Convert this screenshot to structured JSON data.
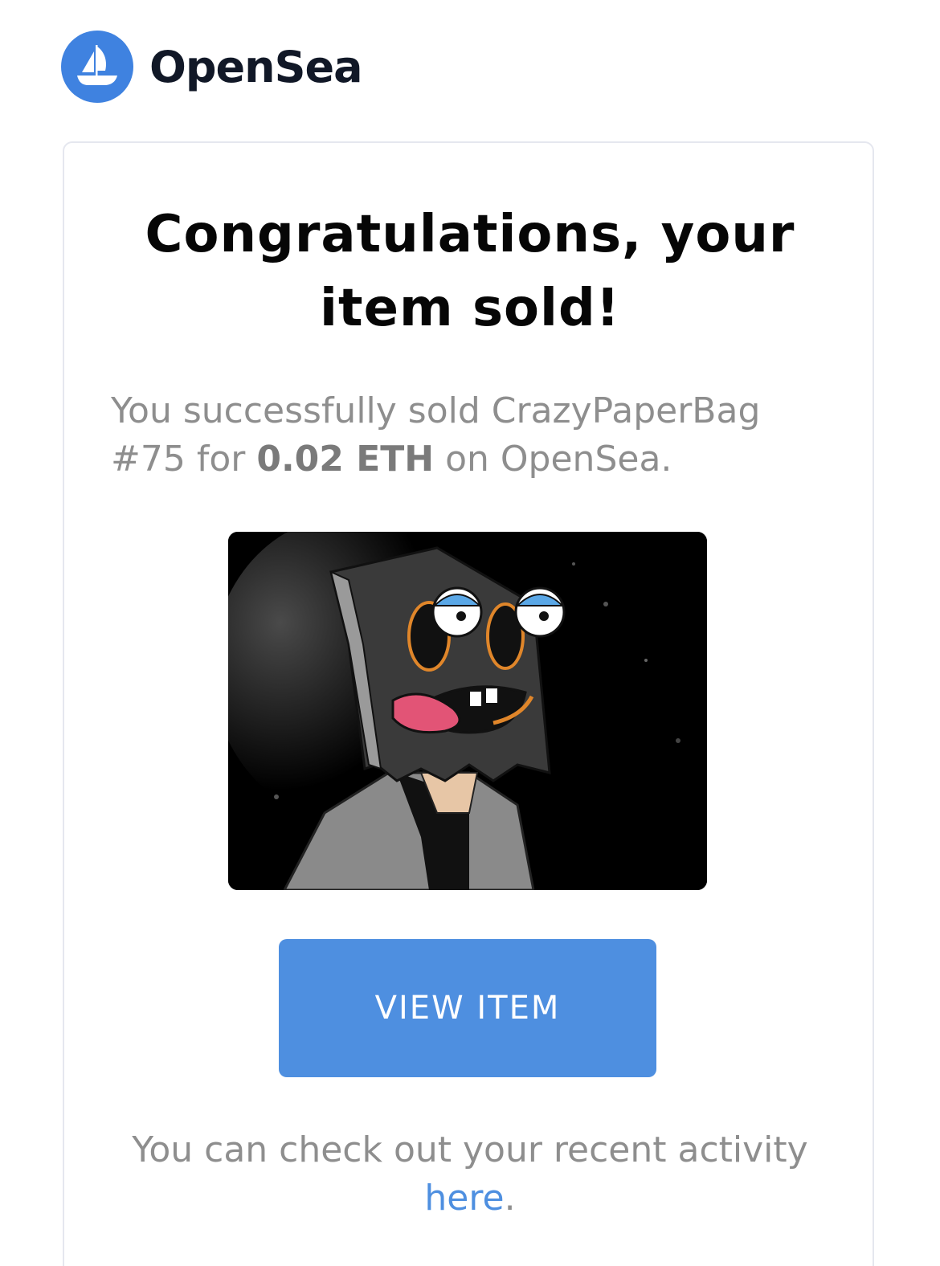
{
  "header": {
    "brand": "OpenSea",
    "logo_icon": "opensea-boat-icon",
    "logo_color": "#3f82e0"
  },
  "email": {
    "headline_line1": "Congratulations, your",
    "headline_line2": "item sold!",
    "message_prefix": "You successfully sold CrazyPaperBag #75 for",
    "price": "0.02 ETH",
    "message_suffix": "on OpenSea.",
    "item_image": "crazypaperbag-75-image",
    "view_button_label": "VIEW ITEM",
    "footer_prefix": "You can check out your recent activity",
    "footer_link": "here",
    "footer_suffix": "."
  },
  "colors": {
    "accent": "#4e8fe0",
    "text_dark": "#060606",
    "text_muted": "#8e8e8e"
  }
}
